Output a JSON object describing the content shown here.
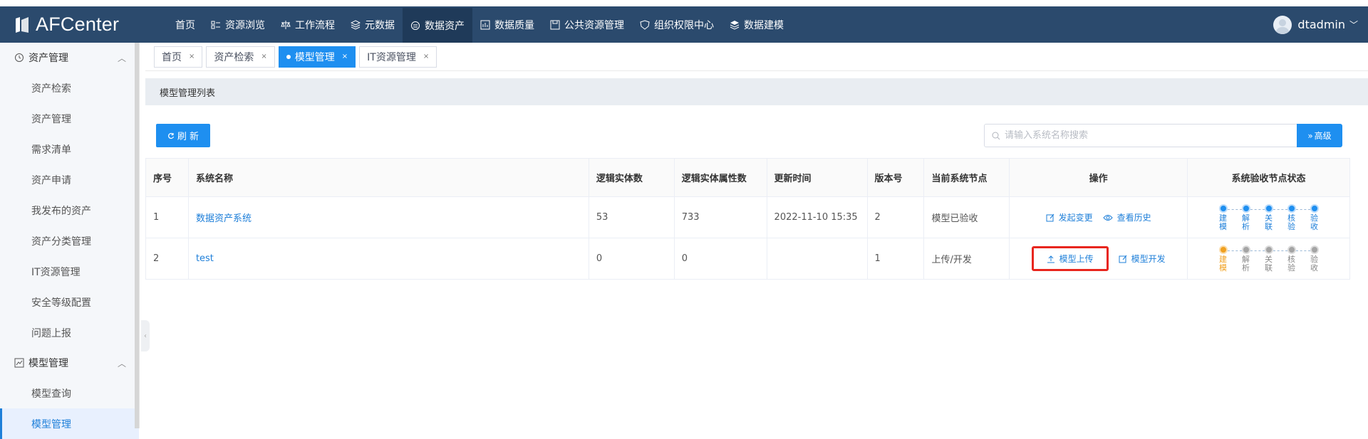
{
  "app": {
    "name": "AFCenter"
  },
  "nav": [
    {
      "label": "首页",
      "icon": "none"
    },
    {
      "label": "资源浏览",
      "icon": "grid-icon"
    },
    {
      "label": "工作流程",
      "icon": "scale-icon"
    },
    {
      "label": "元数据",
      "icon": "layers-icon"
    },
    {
      "label": "数据资产",
      "icon": "asset-icon"
    },
    {
      "label": "数据质量",
      "icon": "chart-icon"
    },
    {
      "label": "公共资源管理",
      "icon": "save-icon"
    },
    {
      "label": "组织权限中心",
      "icon": "shield-icon"
    },
    {
      "label": "数据建模",
      "icon": "layers-icon"
    }
  ],
  "user": {
    "name": "dtadmin"
  },
  "sidebar": {
    "group1": "资产管理",
    "group1_items": [
      "资产检索",
      "资产管理",
      "需求清单",
      "资产申请",
      "我发布的资产",
      "资产分类管理",
      "IT资源管理",
      "安全等级配置",
      "问题上报"
    ],
    "group2": "模型管理",
    "group2_items": [
      "模型查询",
      "模型管理"
    ]
  },
  "tabs": [
    {
      "label": "首页"
    },
    {
      "label": "资产检索"
    },
    {
      "label": "模型管理"
    },
    {
      "label": "IT资源管理"
    }
  ],
  "panel": {
    "title": "模型管理列表"
  },
  "toolbar": {
    "refresh": "刷 新",
    "search_placeholder": "请输入系统名称搜索",
    "advanced": "高级"
  },
  "table": {
    "headers": [
      "序号",
      "系统名称",
      "逻辑实体数",
      "逻辑实体属性数",
      "更新时间",
      "版本号",
      "当前系统节点",
      "操作",
      "系统验收节点状态"
    ],
    "rows": [
      {
        "no": "1",
        "name": "数据资产系统",
        "entities": "53",
        "attrs": "733",
        "updated": "2022-11-10 15:35",
        "version": "2",
        "node": "模型已验收",
        "op1": "发起变更",
        "op2": "查看历史"
      },
      {
        "no": "2",
        "name": "test",
        "entities": "0",
        "attrs": "0",
        "updated": "",
        "version": "1",
        "node": "上传/开发",
        "op1": "模型上传",
        "op2": "模型开发"
      }
    ],
    "steps": [
      "建模",
      "解析",
      "关联",
      "核验",
      "验收"
    ]
  },
  "colors": {
    "primary": "#1e8ff0",
    "topbar": "#2b4a6d",
    "highlight": "#e8261e"
  }
}
